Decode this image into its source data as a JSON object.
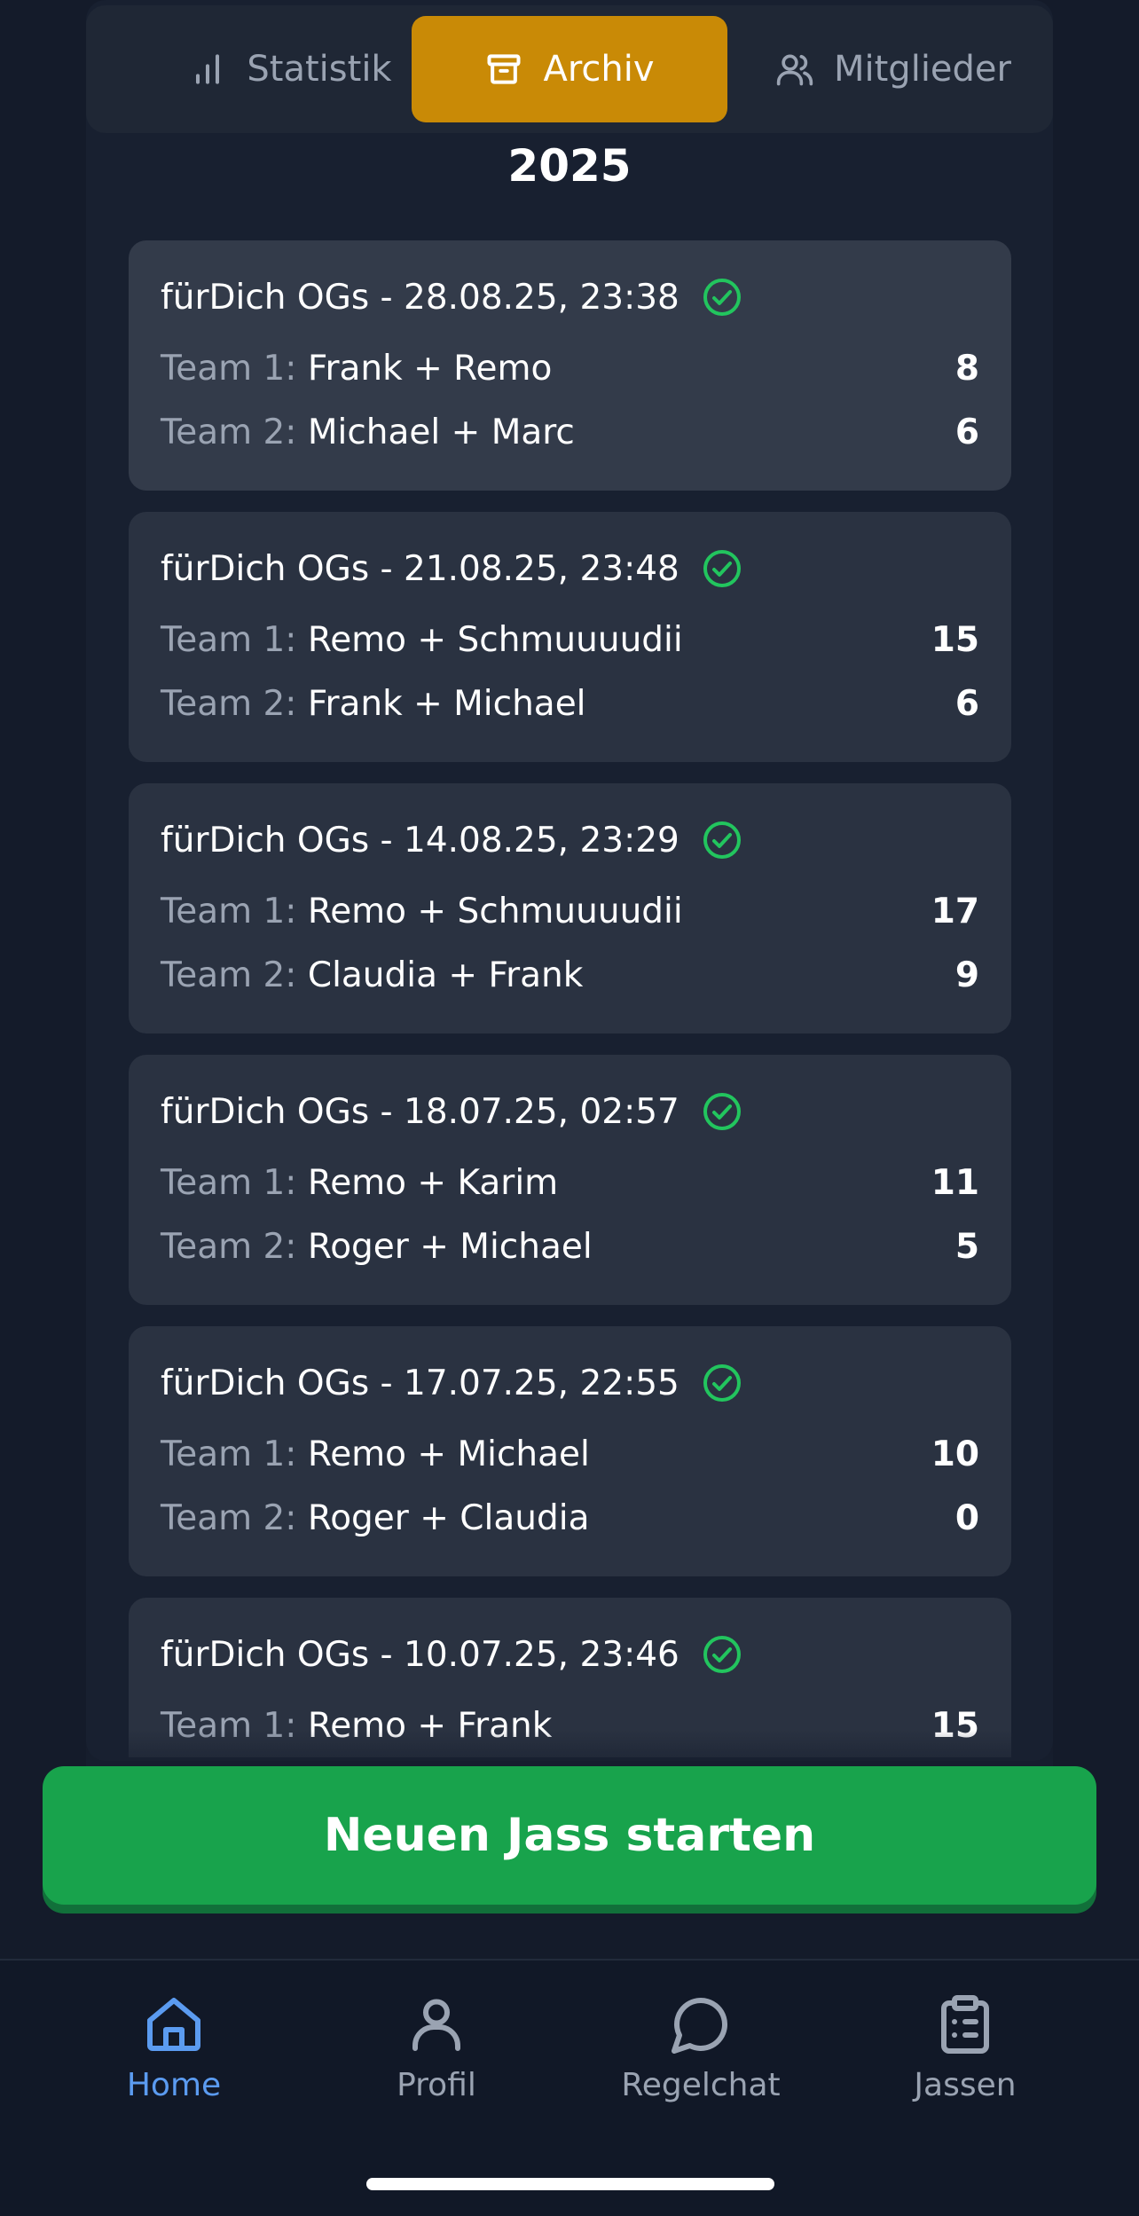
{
  "tabs": [
    {
      "label": "Statistik",
      "icon": "bar-chart-icon",
      "active": false
    },
    {
      "label": "Archiv",
      "icon": "archive-icon",
      "active": true
    },
    {
      "label": "Mitglieder",
      "icon": "users-icon",
      "active": false
    }
  ],
  "year": "2025",
  "games": [
    {
      "title": "fürDich OGs - 28.08.25, 23:38",
      "status_icon": "check-circle-icon",
      "team1": {
        "label": "Team 1:",
        "players": "Frank + Remo",
        "score": "8"
      },
      "team2": {
        "label": "Team 2:",
        "players": "Michael + Marc",
        "score": "6"
      }
    },
    {
      "title": "fürDich OGs - 21.08.25, 23:48",
      "status_icon": "check-circle-icon",
      "team1": {
        "label": "Team 1:",
        "players": "Remo + Schmuuuudii",
        "score": "15"
      },
      "team2": {
        "label": "Team 2:",
        "players": "Frank + Michael",
        "score": "6"
      }
    },
    {
      "title": "fürDich OGs - 14.08.25, 23:29",
      "status_icon": "check-circle-icon",
      "team1": {
        "label": "Team 1:",
        "players": "Remo + Schmuuuudii",
        "score": "17"
      },
      "team2": {
        "label": "Team 2:",
        "players": "Claudia + Frank",
        "score": "9"
      }
    },
    {
      "title": "fürDich OGs - 18.07.25, 02:57",
      "status_icon": "check-circle-icon",
      "team1": {
        "label": "Team 1:",
        "players": "Remo + Karim",
        "score": "11"
      },
      "team2": {
        "label": "Team 2:",
        "players": "Roger + Michael",
        "score": "5"
      }
    },
    {
      "title": "fürDich OGs - 17.07.25, 22:55",
      "status_icon": "check-circle-icon",
      "team1": {
        "label": "Team 1:",
        "players": "Remo + Michael",
        "score": "10"
      },
      "team2": {
        "label": "Team 2:",
        "players": "Roger + Claudia",
        "score": "0"
      }
    },
    {
      "title": "fürDich OGs - 10.07.25, 23:46",
      "status_icon": "check-circle-icon",
      "team1": {
        "label": "Team 1:",
        "players": "Remo + Frank",
        "score": "15"
      },
      "team2": {
        "label": "",
        "players": "",
        "score": ""
      }
    }
  ],
  "cta_label": "Neuen Jass starten",
  "nav": [
    {
      "label": "Home",
      "icon": "home-icon",
      "active": true
    },
    {
      "label": "Profil",
      "icon": "user-icon",
      "active": false
    },
    {
      "label": "Regelchat",
      "icon": "chat-bubble-icon",
      "active": false
    },
    {
      "label": "Jassen",
      "icon": "clipboard-list-icon",
      "active": false
    }
  ],
  "colors": {
    "background": "#141b2a",
    "accent_tab": "#c98a06",
    "cta": "#18a34c",
    "check": "#22c55e",
    "nav_active": "#5b9bf0"
  }
}
